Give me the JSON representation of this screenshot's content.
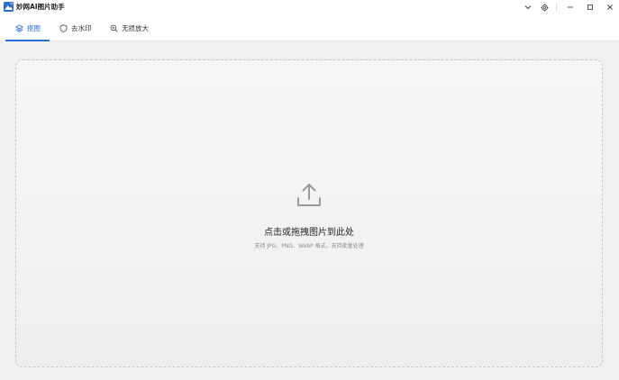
{
  "app": {
    "title": "妙网AI图片助手",
    "accent_color": "#2b6fd6"
  },
  "window_controls": {
    "dropdown_icon": "chevron-down-icon",
    "settings_icon": "gear-icon",
    "minimize_icon": "minimize-icon",
    "maximize_icon": "maximize-icon",
    "close_icon": "close-icon"
  },
  "tabs": [
    {
      "label": "抠图",
      "icon": "layers-icon",
      "active": true
    },
    {
      "label": "去水印",
      "icon": "shield-icon",
      "active": false
    },
    {
      "label": "无损放大",
      "icon": "zoom-in-icon",
      "active": false
    }
  ],
  "dropzone": {
    "icon": "upload-icon",
    "title": "点击或拖拽图片到此处",
    "hint": "支持 JPG、PNG、WebP 格式，支持批量处理"
  }
}
